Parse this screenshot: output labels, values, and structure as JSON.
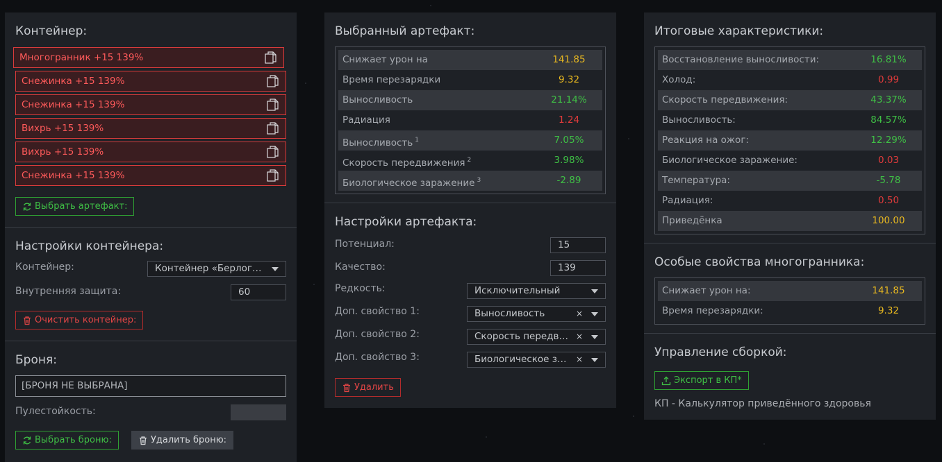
{
  "colors": {
    "positive": "#3fbf45",
    "negative": "#e03b3b",
    "neutral": "#e8b820",
    "panel": "#1e2126",
    "accent_red": "#d93b3b"
  },
  "container": {
    "title": "Контейнер:",
    "artifacts": [
      {
        "label": "Многогранник +15 139%"
      },
      {
        "label": "Снежинка +15 139%"
      },
      {
        "label": "Снежинка +15 139%"
      },
      {
        "label": "Вихрь +15 139%"
      },
      {
        "label": "Вихрь +15 139%"
      },
      {
        "label": "Снежинка +15 139%"
      }
    ],
    "select_button": "Выбрать артефакт:"
  },
  "container_settings": {
    "title": "Настройки контейнера:",
    "container_label": "Контейнер:",
    "container_value": "Контейнер «Берлога...",
    "protection_label": "Внутренняя защита:",
    "protection_value": "60",
    "clear_button": "Очистить контейнер:"
  },
  "armor": {
    "title": "Броня:",
    "armor_value": "[БРОНЯ НЕ ВЫБРАНА]",
    "bullet_label": "Пулестойкость:",
    "bullet_value": "",
    "select_button": "Выбрать броню:",
    "delete_button": "Удалить броню:"
  },
  "selected_artifact": {
    "title": "Выбранный артефакт:",
    "stats": [
      {
        "name": "Снижает урон на",
        "sup": "",
        "value": "141.85",
        "tone": "yel"
      },
      {
        "name": "Время перезарядки",
        "sup": "",
        "value": "9.32",
        "tone": "yel"
      },
      {
        "name": "Выносливость",
        "sup": "",
        "value": "21.14%",
        "tone": "pos"
      },
      {
        "name": "Радиация",
        "sup": "",
        "value": "1.24",
        "tone": "neg"
      },
      {
        "name": "Выносливость",
        "sup": "1",
        "value": "7.05%",
        "tone": "pos"
      },
      {
        "name": "Скорость передвижения",
        "sup": "2",
        "value": "3.98%",
        "tone": "pos"
      },
      {
        "name": "Биологическое заражение",
        "sup": "3",
        "value": "-2.89",
        "tone": "pos"
      }
    ]
  },
  "artifact_settings": {
    "title": "Настройки артефакта:",
    "potential_label": "Потенциал:",
    "potential_value": "15",
    "quality_label": "Качество:",
    "quality_value": "139",
    "rarity_label": "Редкость:",
    "rarity_value": "Исключительный",
    "prop1_label": "Доп. свойство 1:",
    "prop1_value": "Выносливость",
    "prop2_label": "Доп. свойство 2:",
    "prop2_value": "Скорость передви...",
    "prop3_label": "Доп. свойство 3:",
    "prop3_value": "Биологическое за...",
    "clear_symbol": "×",
    "delete_button": "Удалить"
  },
  "totals": {
    "title": "Итоговые характеристики:",
    "stats": [
      {
        "name": "Восстановление выносливости:",
        "value": "16.81%",
        "tone": "pos"
      },
      {
        "name": "Холод:",
        "value": "0.99",
        "tone": "neg"
      },
      {
        "name": "Скорость передвижения:",
        "value": "43.37%",
        "tone": "pos"
      },
      {
        "name": "Выносливость:",
        "value": "84.57%",
        "tone": "pos"
      },
      {
        "name": "Реакция на ожог:",
        "value": "12.29%",
        "tone": "pos"
      },
      {
        "name": "Биологическое заражение:",
        "value": "0.03",
        "tone": "neg"
      },
      {
        "name": "Температура:",
        "value": "-5.78",
        "tone": "pos"
      },
      {
        "name": "Радиация:",
        "value": "0.50",
        "tone": "neg"
      },
      {
        "name": "Приведёнка",
        "value": "100.00",
        "tone": "yel"
      }
    ]
  },
  "special": {
    "title": "Особые свойства многогранника:",
    "stats": [
      {
        "name": "Снижает урон на:",
        "value": "141.85",
        "tone": "yel"
      },
      {
        "name": "Время перезарядки:",
        "value": "9.32",
        "tone": "yel"
      }
    ]
  },
  "build": {
    "title": "Управление сборкой:",
    "export_button": "Экспорт в КП*",
    "footnote": "КП - Калькулятор приведённого здоровья"
  }
}
